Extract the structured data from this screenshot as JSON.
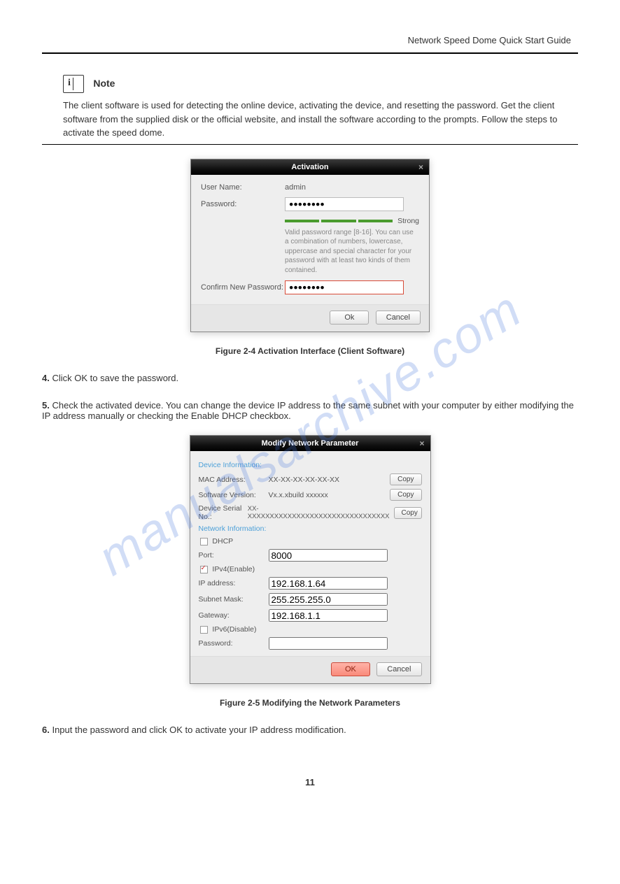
{
  "header": {
    "title": "Network Speed Dome Quick Start Guide"
  },
  "note": {
    "title": "Note",
    "text": "The client software is used for detecting the online device, activating the device, and resetting the password.\nGet the client software from the supplied disk or the official website, and install the software according to the prompts. Follow the steps to activate the speed dome."
  },
  "steps": {
    "s4": {
      "num": "4.",
      "text": "Click OK to save the password."
    },
    "s5": {
      "num": "5.",
      "text": "Check the activated device. You can change the device IP address to the same subnet with your computer by either modifying the IP address manually or checking the Enable DHCP checkbox."
    },
    "s6": {
      "num": "6.",
      "text": "Input the password and click OK to activate your IP address modification."
    }
  },
  "dialog1": {
    "title": "Activation",
    "user_label": "User Name:",
    "user_value": "admin",
    "password_label": "Password:",
    "password_value": "●●●●●●●●",
    "strength": "Strong",
    "hint": "Valid password range [8-16]. You can use a combination of numbers, lowercase, uppercase and special character for your password with at least two kinds of them contained.",
    "confirm_label": "Confirm New Password:",
    "confirm_value": "●●●●●●●●",
    "ok": "Ok",
    "cancel": "Cancel"
  },
  "fig1": "Figure 2-4 Activation Interface (Client Software)",
  "dialog2": {
    "title": "Modify Network Parameter",
    "sec_device": "Device Information:",
    "mac_label": "MAC Address:",
    "mac_value": "XX-XX-XX-XX-XX-XX",
    "sw_label": "Software Version:",
    "sw_value": "Vx.x.xbuild xxxxxx",
    "serial_label": "Device Serial No.:",
    "serial_value": "XX-XXXXXXXXXXXXXXXXXXXXXXXXXXXXXXXX",
    "copy": "Copy",
    "sec_network": "Network Information:",
    "dhcp": "DHCP",
    "port_label": "Port:",
    "port_value": "8000",
    "ipv4_enable": "IPv4(Enable)",
    "ip_label": "IP address:",
    "ip_value": "192.168.1.64",
    "mask_label": "Subnet Mask:",
    "mask_value": "255.255.255.0",
    "gw_label": "Gateway:",
    "gw_value": "192.168.1.1",
    "ipv6_disable": "IPv6(Disable)",
    "password_label": "Password:",
    "ok": "OK",
    "cancel": "Cancel"
  },
  "fig2": "Figure 2-5 Modifying the Network Parameters",
  "watermark": "manualsarchive.com",
  "page_num": "11"
}
